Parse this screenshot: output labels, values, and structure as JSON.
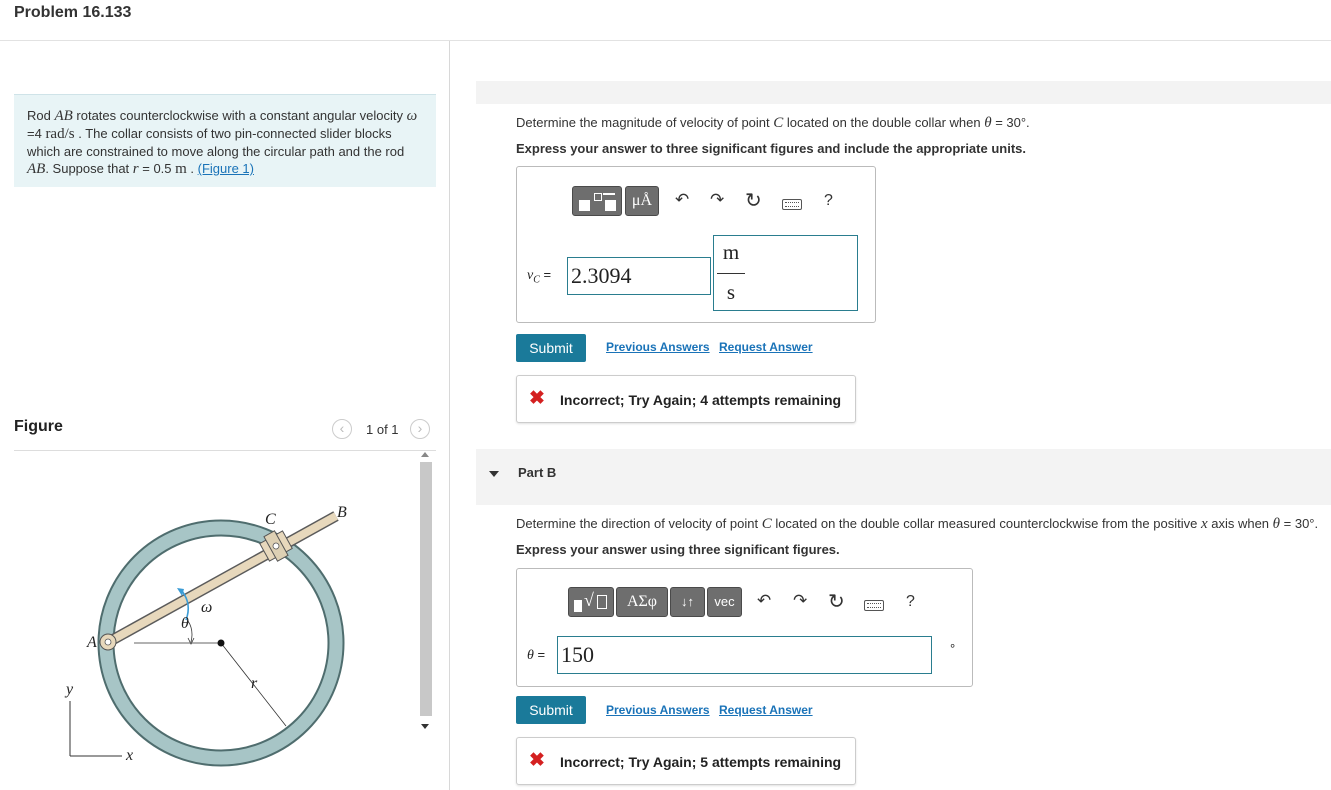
{
  "problem": {
    "title": "Problem 16.133",
    "statement": {
      "t1": "Rod ",
      "AB": "AB",
      "t2": " rotates counterclockwise with a constant angular velocity",
      "omega": "ω",
      "eq": " =4 ",
      "unit": "rad/s",
      "t3": " . The collar consists of two pin-connected slider blocks which are constrained to move along the circular path and the rod ",
      "AB2": "AB",
      "t4": ". Suppose that ",
      "r": "r",
      "req": " = 0.5 ",
      "m": "m",
      "t5": " . ",
      "figure_link": "(Figure 1)"
    }
  },
  "figure": {
    "label": "Figure",
    "counter": "1 of 1",
    "prev_icon": "chevron-left-icon",
    "next_icon": "chevron-right-icon",
    "labels": {
      "A": "A",
      "B": "B",
      "C": "C",
      "omega": "ω",
      "theta": "θ",
      "r": "r",
      "x": "x",
      "y": "y"
    }
  },
  "part_a": {
    "question": {
      "t1": "Determine the magnitude of velocity of point ",
      "C": "C",
      "t2": " located on the double collar when ",
      "theta": "θ",
      "t3": " = 30°."
    },
    "instruction": "Express your answer to three significant figures and include the appropriate units.",
    "toolbar": {
      "template_icon": "fraction-template-icon",
      "units_label": "μÅ",
      "undo_icon": "undo-icon",
      "redo_icon": "redo-icon",
      "reset_icon": "reset-icon",
      "keyboard_icon": "keyboard-icon",
      "help_label": "?"
    },
    "var_label": "vC",
    "var_label_main": "v",
    "var_label_sub": "C",
    "equals": "=",
    "value": "2.3094",
    "unit_num": "m",
    "unit_den": "s",
    "submit_label": "Submit",
    "previous_answers": "Previous Answers",
    "request_answer": "Request Answer",
    "feedback_icon": "incorrect-x-icon",
    "feedback": "Incorrect; Try Again; 4 attempts remaining"
  },
  "part_b": {
    "header": "Part B",
    "toggle_icon": "caret-down-icon",
    "question": {
      "t1": "Determine the direction of velocity of point ",
      "C": "C",
      "t2": " located on the double collar measured counterclockwise from the positive ",
      "x": "x",
      "t3": " axis when ",
      "theta": "θ",
      "t4": " = 30°."
    },
    "instruction": "Express your answer using three significant figures.",
    "toolbar": {
      "template_icon": "sqrt-template-icon",
      "greek_label": "ΑΣφ",
      "arrows_label": "↓↑",
      "vec_label": "vec",
      "undo_icon": "undo-icon",
      "redo_icon": "redo-icon",
      "reset_icon": "reset-icon",
      "keyboard_icon": "keyboard-icon",
      "help_label": "?"
    },
    "var_label": "θ",
    "equals": "=",
    "value": "150",
    "unit": "°",
    "submit_label": "Submit",
    "previous_answers": "Previous Answers",
    "request_answer": "Request Answer",
    "feedback_icon": "incorrect-x-icon",
    "feedback": "Incorrect; Try Again; 5 attempts remaining"
  },
  "colors": {
    "accent": "#1a7a9a",
    "link": "#1a73b8",
    "error": "#d42020",
    "problem_bg": "#e8f4f6",
    "ring": "#9fbfc0"
  }
}
